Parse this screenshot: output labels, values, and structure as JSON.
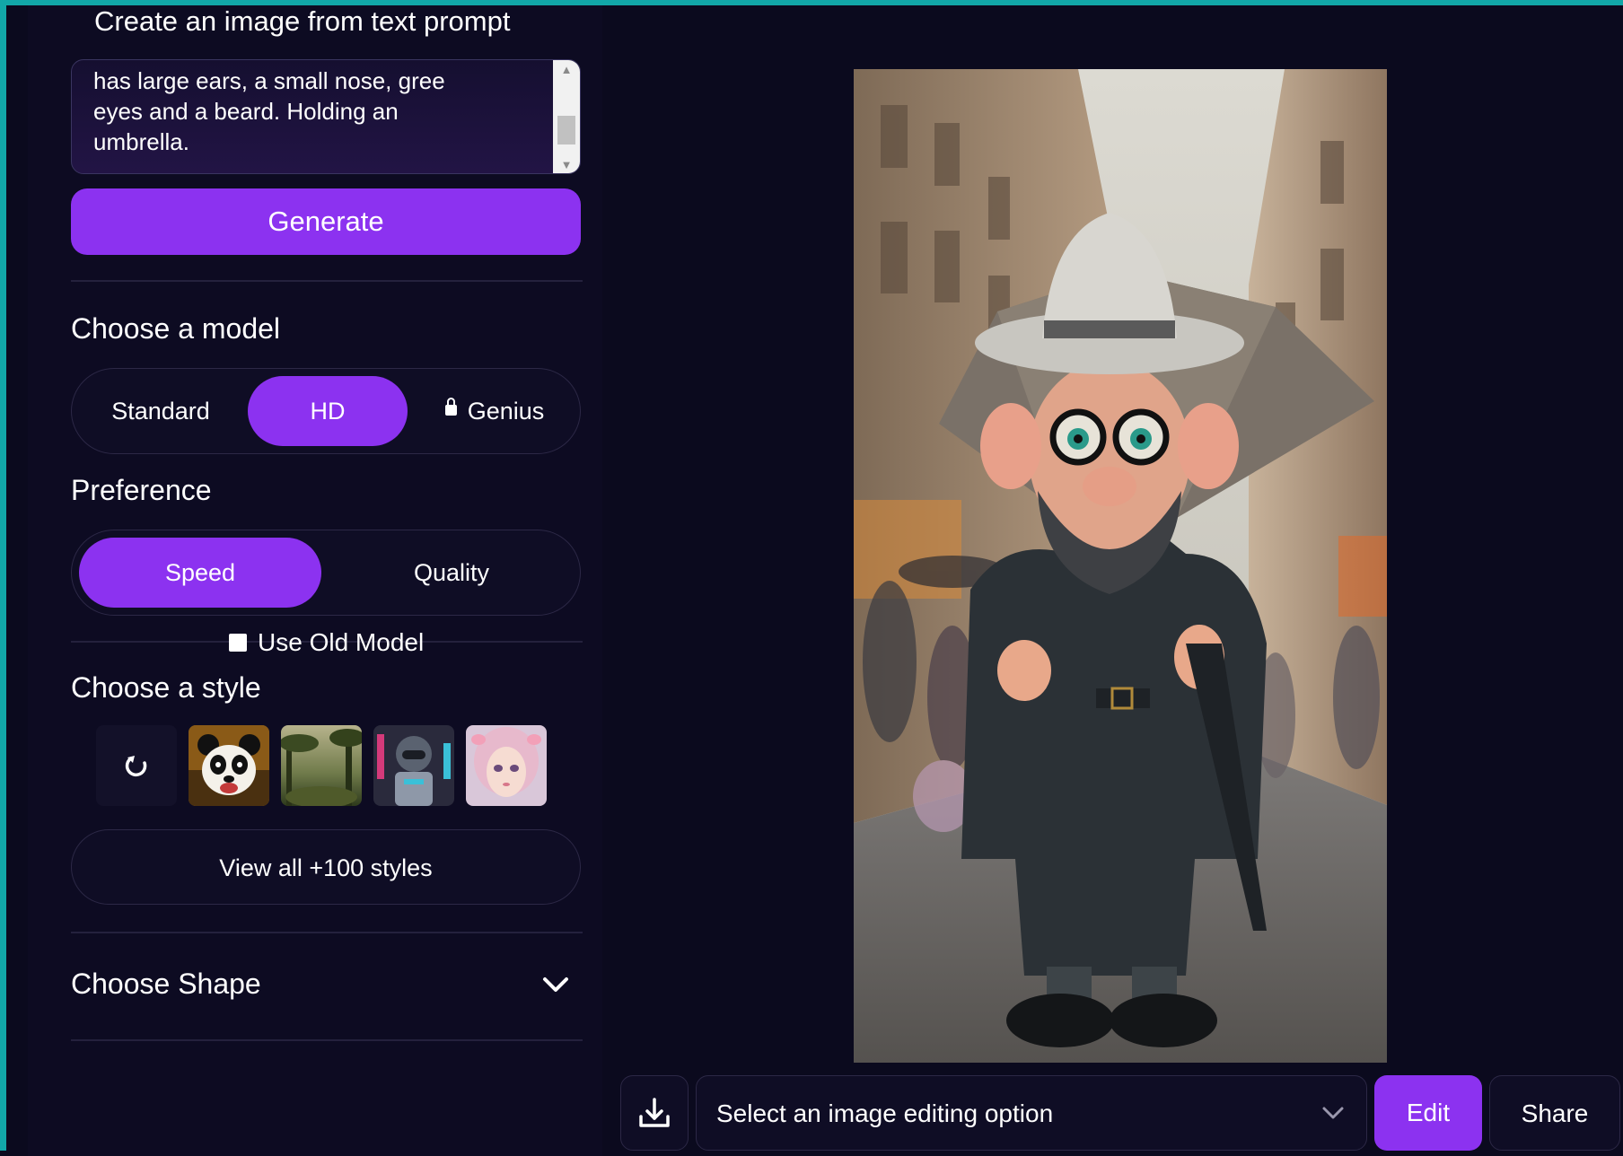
{
  "prompt": {
    "heading": "Create an image from text prompt",
    "text_lines": [
      "has large ears, a small nose, gree",
      "eyes and a beard. Holding an",
      "umbrella."
    ]
  },
  "generate": {
    "label": "Generate"
  },
  "model": {
    "title": "Choose a model",
    "options": [
      "Standard",
      "HD",
      "Genius"
    ],
    "selected": "HD",
    "locked": [
      "Genius"
    ]
  },
  "preference": {
    "title": "Preference",
    "options": [
      "Speed",
      "Quality"
    ],
    "selected": "Speed"
  },
  "old_model": {
    "label": "Use Old Model",
    "checked": false
  },
  "style": {
    "title": "Choose a style",
    "thumbnails": [
      "refresh-icon",
      "panda",
      "jungle",
      "robot",
      "anime-girl"
    ],
    "view_all_label": "View all +100 styles"
  },
  "shape": {
    "title": "Choose Shape"
  },
  "actions": {
    "edit_select_placeholder": "Select an image editing option",
    "edit_label": "Edit",
    "share_label": "Share"
  },
  "colors": {
    "accent": "#8c32f0",
    "background": "#0b0a1e",
    "frame": "#12a7a8"
  }
}
